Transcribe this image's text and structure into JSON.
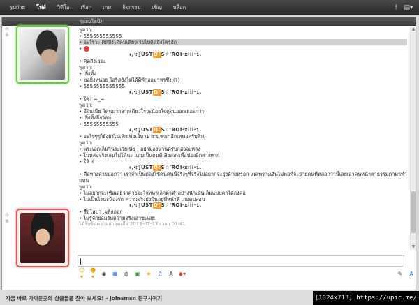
{
  "nav": {
    "items": [
      {
        "label": "รูปถ่าย",
        "active": false
      },
      {
        "label": "โฟล์",
        "active": true
      },
      {
        "label": "วิดีโอ",
        "active": false
      },
      {
        "label": "เรือก",
        "active": false
      },
      {
        "label": "เกม",
        "active": false
      },
      {
        "label": "กิจกรรม",
        "active": false
      },
      {
        "label": "เชิญ",
        "active": false
      },
      {
        "label": "บล็อก",
        "active": false
      }
    ]
  },
  "header": {
    "status": "(ออนไลน์)"
  },
  "chat": {
    "lines": [
      {
        "type": "speaker",
        "text": "พูดว่า:"
      },
      {
        "type": "msg",
        "text": "555555555555"
      },
      {
        "type": "msg",
        "text": "อะไรวะ คิดถึงได้คนเดียวเว้ยไปคิดถึงใครอีก",
        "highlight": true
      },
      {
        "type": "emoji"
      },
      {
        "type": "sig",
        "pre": "ء,·:'JUST",
        "box": "OI",
        "post": "S☆'ROI·xiii·ɿ."
      },
      {
        "type": "msg",
        "text": "คิดถึงเยอะ"
      },
      {
        "type": "speaker",
        "text": "พูดว่า:"
      },
      {
        "type": "msg",
        "text": ".ยิ้งทิ้ง"
      },
      {
        "type": "msg",
        "text": "ขอยิ้งหน่อย ไอริสยังไม่ได้ดีพักออมาหรซึ่ง (?)"
      },
      {
        "type": "msg",
        "text": "5555555555555"
      },
      {
        "type": "sig",
        "pre": "ء,·:'JUST",
        "box": "OI",
        "post": "S☆'ROI·xiii·ɿ."
      },
      {
        "type": "msg",
        "text": "ใคร =_="
      },
      {
        "type": "speaker",
        "text": "พูดว่า:"
      },
      {
        "type": "msg",
        "text": "อีจินเนี่ย โดนมากจากเดียวโรวะน้อยใจดูจนออกเยอะกว่า"
      },
      {
        "type": "msg",
        "text": ".ยิ้งทิ้งอีกรอบ"
      },
      {
        "type": "msg",
        "text": "55555555555"
      },
      {
        "type": "sig",
        "pre": "ء,·:'JUST",
        "box": "OI",
        "post": "S☆'ROI·xiii·ɿ."
      },
      {
        "type": "msg",
        "text": "อะไรๆๆก็ยังยังไม่เลิกเพ่อเอ็ทา1 it's war อีกเทพอครับพี่!!"
      },
      {
        "type": "speaker",
        "text": "พูดว่า:"
      },
      {
        "type": "msg",
        "text": "พระเอกเล็มวิ่นระเว้ยเนี่ย ! อย่ามองนานครับกลัวจะหลง"
      },
      {
        "type": "msg",
        "text": "ไม่หล่อจริงเล่นไม่ได้นะ แถมเป็นคนดีเสียสละเพื่อน้องอีกต่างหาก"
      },
      {
        "type": "msg",
        "text": "ให้ ✌"
      },
      {
        "type": "sig",
        "pre": "ء,·:'JUST",
        "box": "OI",
        "post": "S☆'ROI·xiii·ɿ."
      },
      {
        "type": "msg",
        "text": "คือทางค่ายบอกว่า เราจำเป็นต้องใช้คนคนนี้จริงๆที่จริงไม่อยากจะยุ่งด้วยหรอก แต่เพราะเงินไม่พอที่จะจ่ายคนที่หล่อกว่านี้เลยเอาคนหน้าตาธรรมดามาทำแทน",
        "wrap": true
      },
      {
        "type": "speaker",
        "text": "พูดว่า:"
      },
      {
        "type": "msg",
        "text": "ไม่อยากจะเชื่อเลยว่าค่ายจะใจทหาเล็กตาต่ำอย่างนักเน้นเล็มแบบคาได้ลงคอ"
      },
      {
        "type": "msg",
        "text": "ไม่เป็นไรนะน้องรัก ความจริงยังมีนอยู่ที่หน้าพี่ .กอดปลอบ"
      },
      {
        "type": "sig",
        "pre": "ء,·:'JUST",
        "box": "OI",
        "post": "S☆'ROI·xiii·ɿ."
      },
      {
        "type": "msg",
        "text": "สื่อโลปา .ผลักออก"
      },
      {
        "type": "msg",
        "text": "ไม่รู้จักยอมรับความจริงเอาซะเลย"
      },
      {
        "type": "time",
        "text": "ได้รับข้อความล่าสุดเมื่อ 2013-02-17 เวลา 01:41"
      }
    ]
  },
  "footer": {
    "ad": "지금 바로 가까운곳의 싱글들을 찾아 보세요! - Joinsmsn 친구사귀기"
  },
  "watermark": {
    "text": "[1024x713] https://upic.me/"
  }
}
